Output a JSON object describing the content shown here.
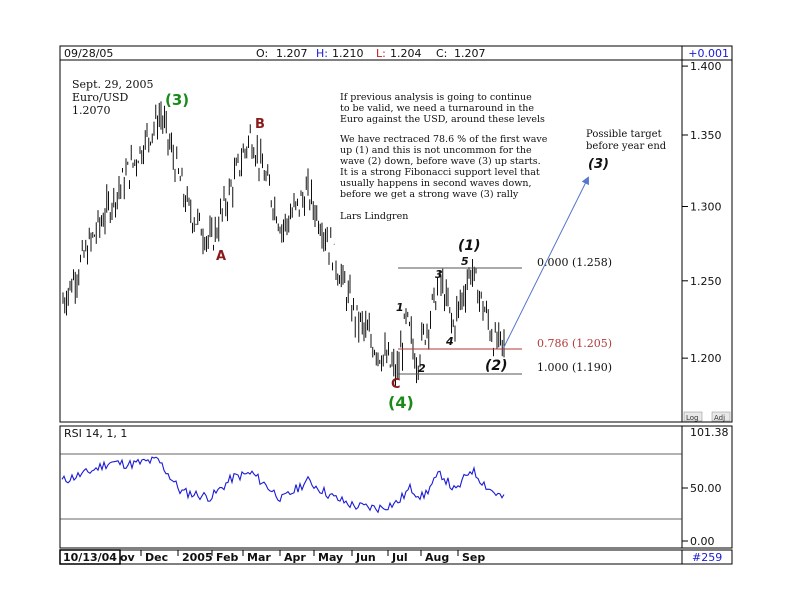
{
  "header": {
    "date": "09/28/05",
    "open_label": "O:",
    "open": "1.207",
    "high_label": "H:",
    "high": "1.210",
    "low_label": "L:",
    "low": "1.204",
    "close_label": "C:",
    "close": "1.207",
    "change": "+0.001"
  },
  "footer": {
    "start_date": "10/13/04",
    "count": "#259",
    "months": [
      "ov",
      "Dec",
      "2005",
      "Feb",
      "Mar",
      "Apr",
      "May",
      "Jun",
      "Jul",
      "Aug",
      "Sep"
    ]
  },
  "info": {
    "date": "Sept. 29, 2005",
    "pair": "Euro/USD",
    "price": "1.2070"
  },
  "commentary": {
    "p1": [
      "If previous analysis is going to continue",
      "to be valid, we need a turnaround in the",
      "Euro against the USD, around these levels"
    ],
    "p2": [
      "We have rectraced 78.6 % of the first wave",
      "up (1) and this is not uncommon for the",
      "wave (2) down, before wave (3) up starts.",
      "It is a strong Fibonacci support level that",
      "usually happens in second waves down,",
      "before we get a strong wave (3) rally"
    ],
    "author": "Lars Lindgren"
  },
  "target": {
    "line1": "Possible target",
    "line2": "before year end",
    "label": "(3)"
  },
  "fib": {
    "f0": "0.000 (1.258)",
    "f786": "0.786 (1.205)",
    "f1": "1.000 (1.190)"
  },
  "waves": {
    "w3_major": "(3)",
    "w4_major": "(4)",
    "A": "A",
    "B": "B",
    "C": "C",
    "w1_paren": "(1)",
    "w2_paren": "(2)",
    "w1": "1",
    "w2": "2",
    "w3": "3",
    "w4": "4",
    "w5": "5"
  },
  "price_axis": {
    "ticks": [
      "1.400",
      "1.350",
      "1.300",
      "1.250",
      "1.200"
    ],
    "log_label": "Log",
    "adj_label": "Adj"
  },
  "rsi": {
    "label": "RSI 14, 1, 1",
    "top_value": "101.38",
    "mid_value": "50.00",
    "bottom_value": "0.00"
  },
  "colors": {
    "price_bars": "#111111",
    "rsi_line": "#1a1ad6",
    "green_label": "#1b8a1b",
    "red_label": "#8b1a1a",
    "fib_786": "#b23a3a",
    "projection": "#5577cc"
  },
  "chart_data": [
    {
      "type": "ohlc",
      "ylim": [
        1.175,
        1.4
      ],
      "y_axis_scale": "log",
      "x_categories": [
        "ov",
        "Dec",
        "2005",
        "Feb",
        "Mar",
        "Apr",
        "May",
        "Jun",
        "Jul",
        "Aug",
        "Sep"
      ],
      "start_date": "10/13/04",
      "pivots": [
        {
          "date": "2004-10-13",
          "value": 1.235
        },
        {
          "date": "2004-11-10",
          "value": 1.285
        },
        {
          "date": "2004-12-30",
          "value": 1.365
        },
        {
          "date": "2005-01-20",
          "value": 1.3
        },
        {
          "date": "2005-02-08",
          "value": 1.275
        },
        {
          "date": "2005-03-11",
          "value": 1.35
        },
        {
          "date": "2005-04-05",
          "value": 1.285
        },
        {
          "date": "2005-04-25",
          "value": 1.31
        },
        {
          "date": "2005-05-10",
          "value": 1.28
        },
        {
          "date": "2005-05-31",
          "value": 1.23
        },
        {
          "date": "2005-06-15",
          "value": 1.21
        },
        {
          "date": "2005-07-05",
          "value": 1.19
        },
        {
          "date": "2005-07-12",
          "value": 1.225
        },
        {
          "date": "2005-07-20",
          "value": 1.198
        },
        {
          "date": "2005-08-08",
          "value": 1.25
        },
        {
          "date": "2005-08-18",
          "value": 1.22
        },
        {
          "date": "2005-09-01",
          "value": 1.258
        },
        {
          "date": "2005-09-20",
          "value": 1.21
        },
        {
          "date": "2005-09-28",
          "value": 1.207
        }
      ]
    },
    {
      "type": "line",
      "name": "RSI 14, 1, 1",
      "ylim": [
        0,
        101.38
      ],
      "points": [
        {
          "date": "2004-10-13",
          "value": 55
        },
        {
          "date": "2004-11-01",
          "value": 62
        },
        {
          "date": "2004-11-20",
          "value": 72
        },
        {
          "date": "2004-12-05",
          "value": 70
        },
        {
          "date": "2004-12-28",
          "value": 74
        },
        {
          "date": "2005-01-15",
          "value": 45
        },
        {
          "date": "2005-02-08",
          "value": 40
        },
        {
          "date": "2005-02-25",
          "value": 58
        },
        {
          "date": "2005-03-12",
          "value": 62
        },
        {
          "date": "2005-04-05",
          "value": 38
        },
        {
          "date": "2005-04-25",
          "value": 55
        },
        {
          "date": "2005-05-15",
          "value": 40
        },
        {
          "date": "2005-06-01",
          "value": 32
        },
        {
          "date": "2005-06-20",
          "value": 30
        },
        {
          "date": "2005-07-05",
          "value": 35
        },
        {
          "date": "2005-07-15",
          "value": 48
        },
        {
          "date": "2005-07-25",
          "value": 40
        },
        {
          "date": "2005-08-08",
          "value": 62
        },
        {
          "date": "2005-08-20",
          "value": 45
        },
        {
          "date": "2005-09-01",
          "value": 66
        },
        {
          "date": "2005-09-15",
          "value": 48
        },
        {
          "date": "2005-09-28",
          "value": 38
        }
      ]
    }
  ]
}
